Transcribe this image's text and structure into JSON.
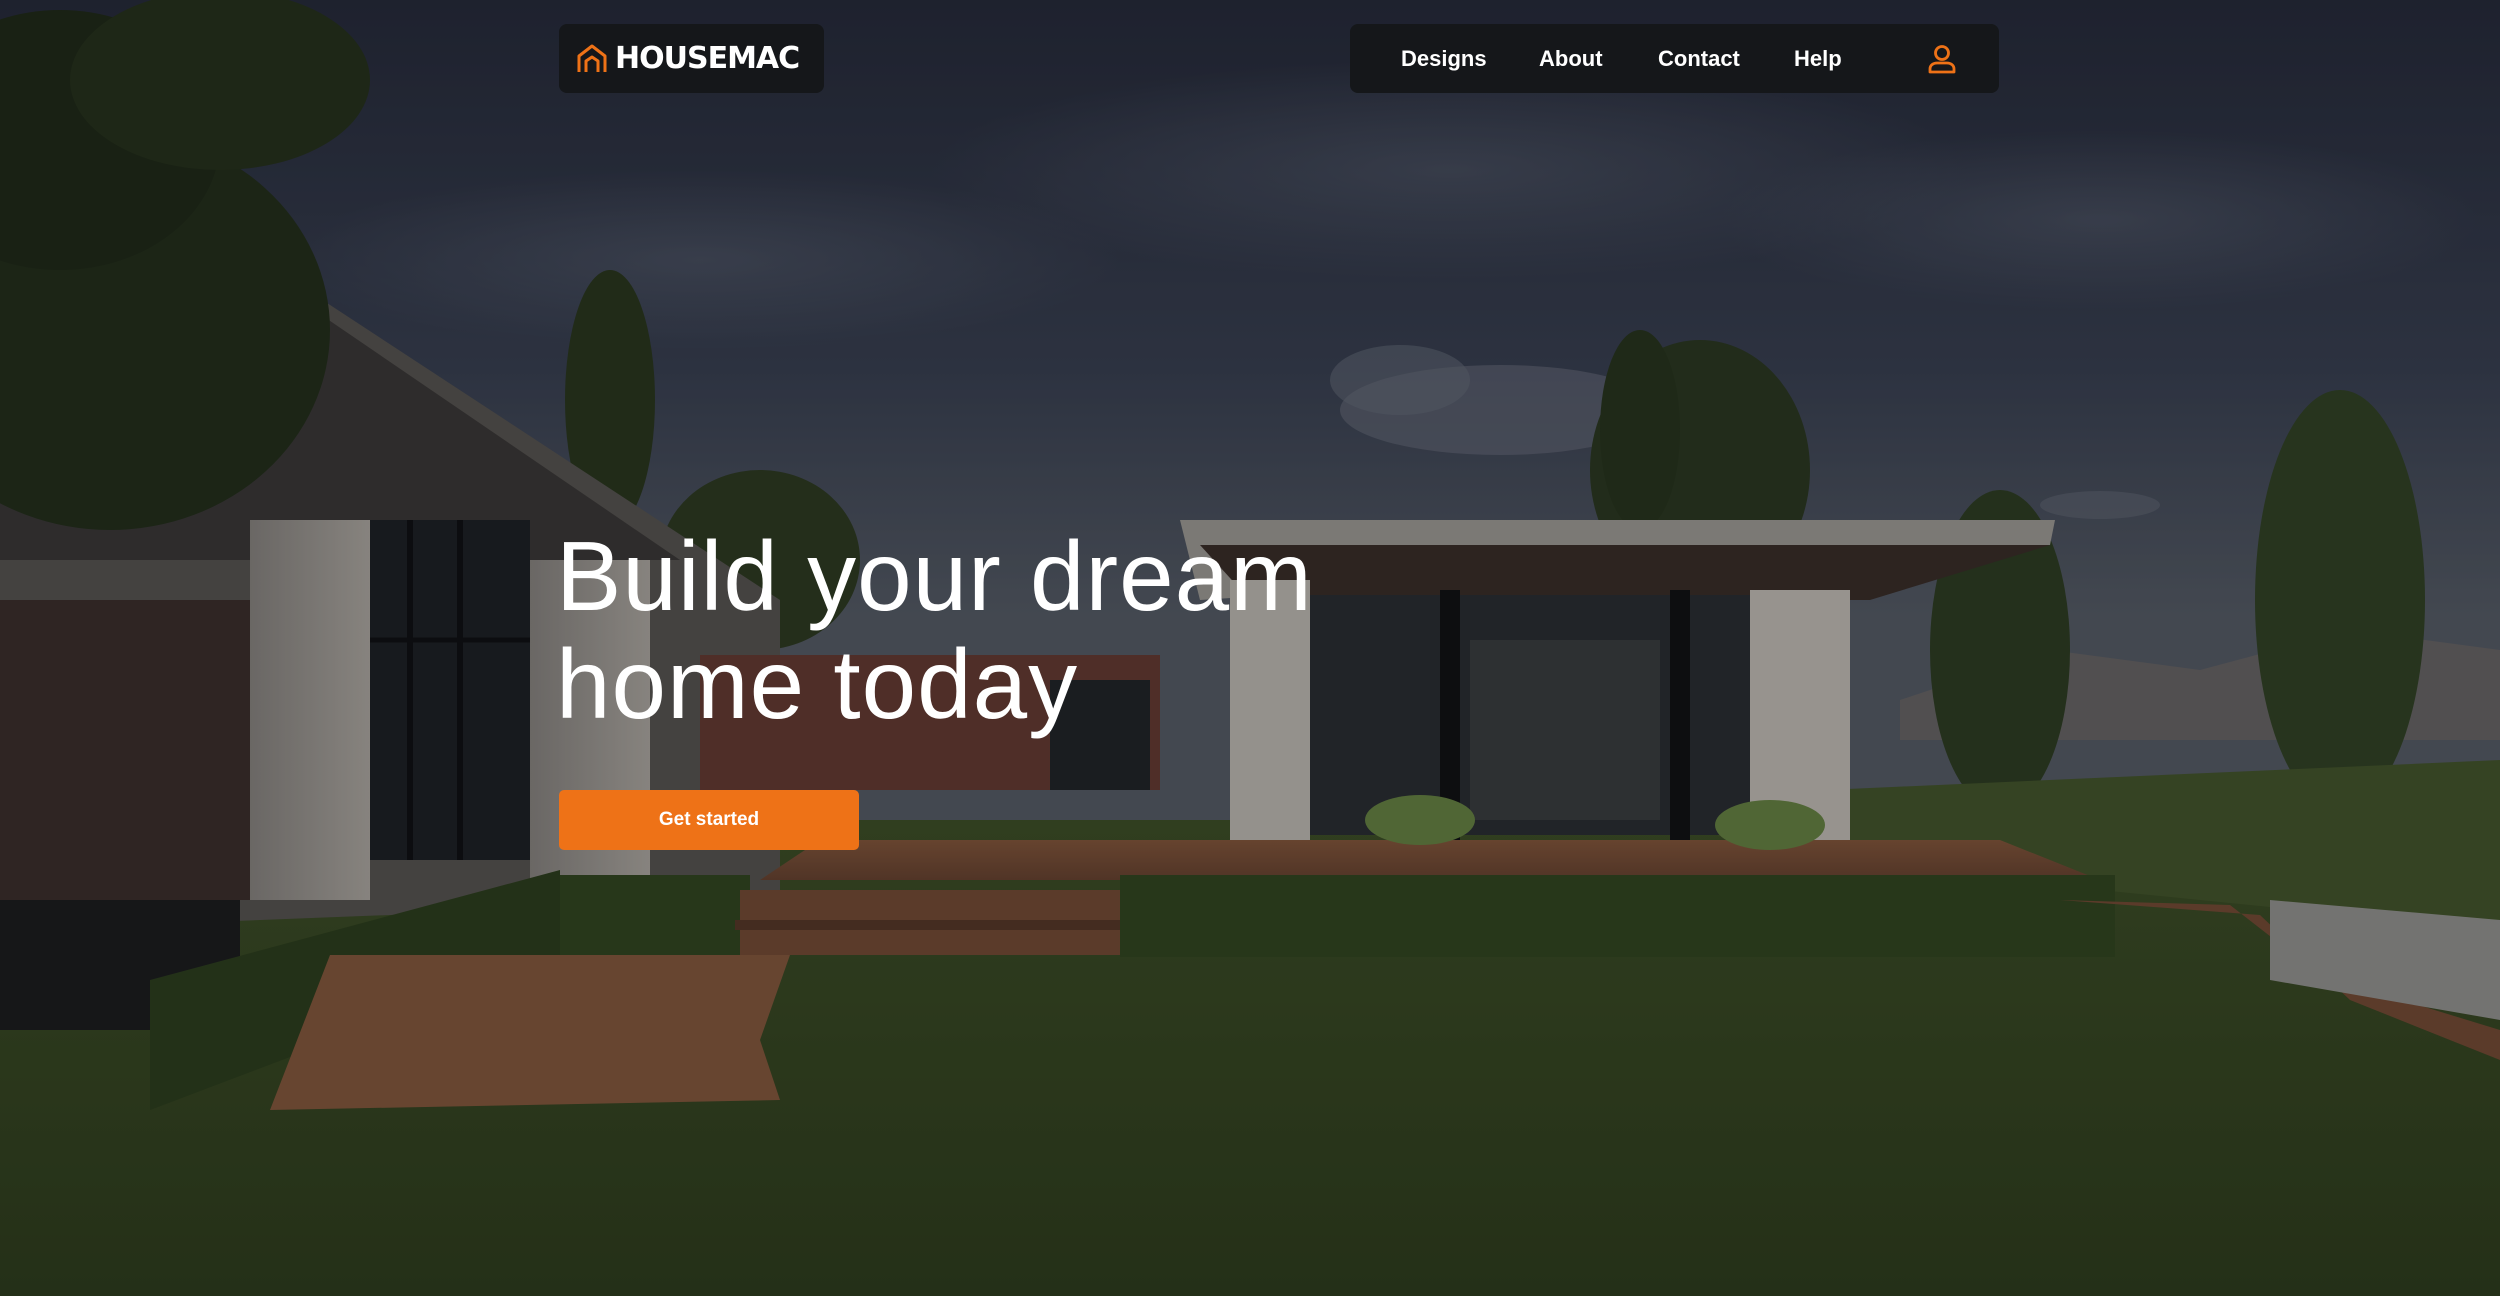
{
  "brand": {
    "name": "HOUSEMAC",
    "icon": "house-outline-icon",
    "accent_color": "#ee7217"
  },
  "nav": {
    "items": [
      {
        "label": "Designs"
      },
      {
        "label": "About"
      },
      {
        "label": "Contact"
      },
      {
        "label": "Help"
      }
    ],
    "user_icon": "user-icon"
  },
  "hero": {
    "headline_line1": "Build your dream",
    "headline_line2": "home today",
    "cta_label": "Get started",
    "background": "modern-house-garden-render"
  }
}
